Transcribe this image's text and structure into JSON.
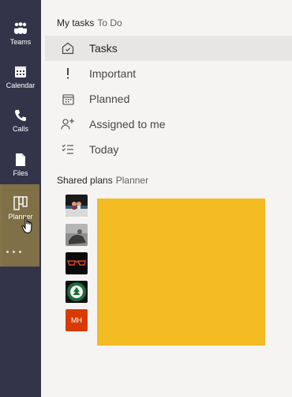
{
  "rail": {
    "items": [
      {
        "label": "Teams",
        "icon": "teams-icon"
      },
      {
        "label": "Calendar",
        "icon": "calendar-icon"
      },
      {
        "label": "Calls",
        "icon": "phone-icon"
      },
      {
        "label": "Files",
        "icon": "file-icon"
      },
      {
        "label": "Planner",
        "icon": "planner-icon"
      }
    ],
    "selected_color": "#857447"
  },
  "nav": {
    "crumb_main": "My tasks",
    "crumb_sub": "To Do",
    "items": [
      {
        "label": "Tasks",
        "icon": "home-icon",
        "active": true
      },
      {
        "label": "Important",
        "icon": "exclamation-icon"
      },
      {
        "label": "Planned",
        "icon": "calendar-grid-icon"
      },
      {
        "label": "Assigned to me",
        "icon": "person-add-icon"
      },
      {
        "label": "Today",
        "icon": "list-check-icon"
      }
    ]
  },
  "shared": {
    "crumb_main": "Shared plans",
    "crumb_sub": "Planner",
    "plans": [
      {
        "icon": "plan-thumbnail-boxing-ring"
      },
      {
        "icon": "plan-thumbnail-photo"
      },
      {
        "icon": "plan-thumbnail-glasses"
      },
      {
        "icon": "plan-thumbnail-tree-badge"
      },
      {
        "initials": "MH",
        "color": "#d83b01"
      }
    ],
    "tile_color": "#f3bb22"
  }
}
